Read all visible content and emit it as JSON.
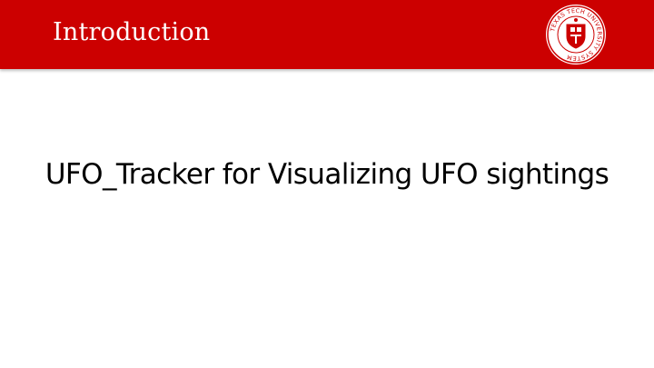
{
  "header": {
    "title": "Introduction",
    "band_color": "#cc0000",
    "seal": {
      "icon": "university-seal-icon",
      "ring_text": "TEXAS TECH UNIVERSITY SYSTEM"
    }
  },
  "main": {
    "text": "UFO_Tracker for Visualizing UFO sightings"
  }
}
